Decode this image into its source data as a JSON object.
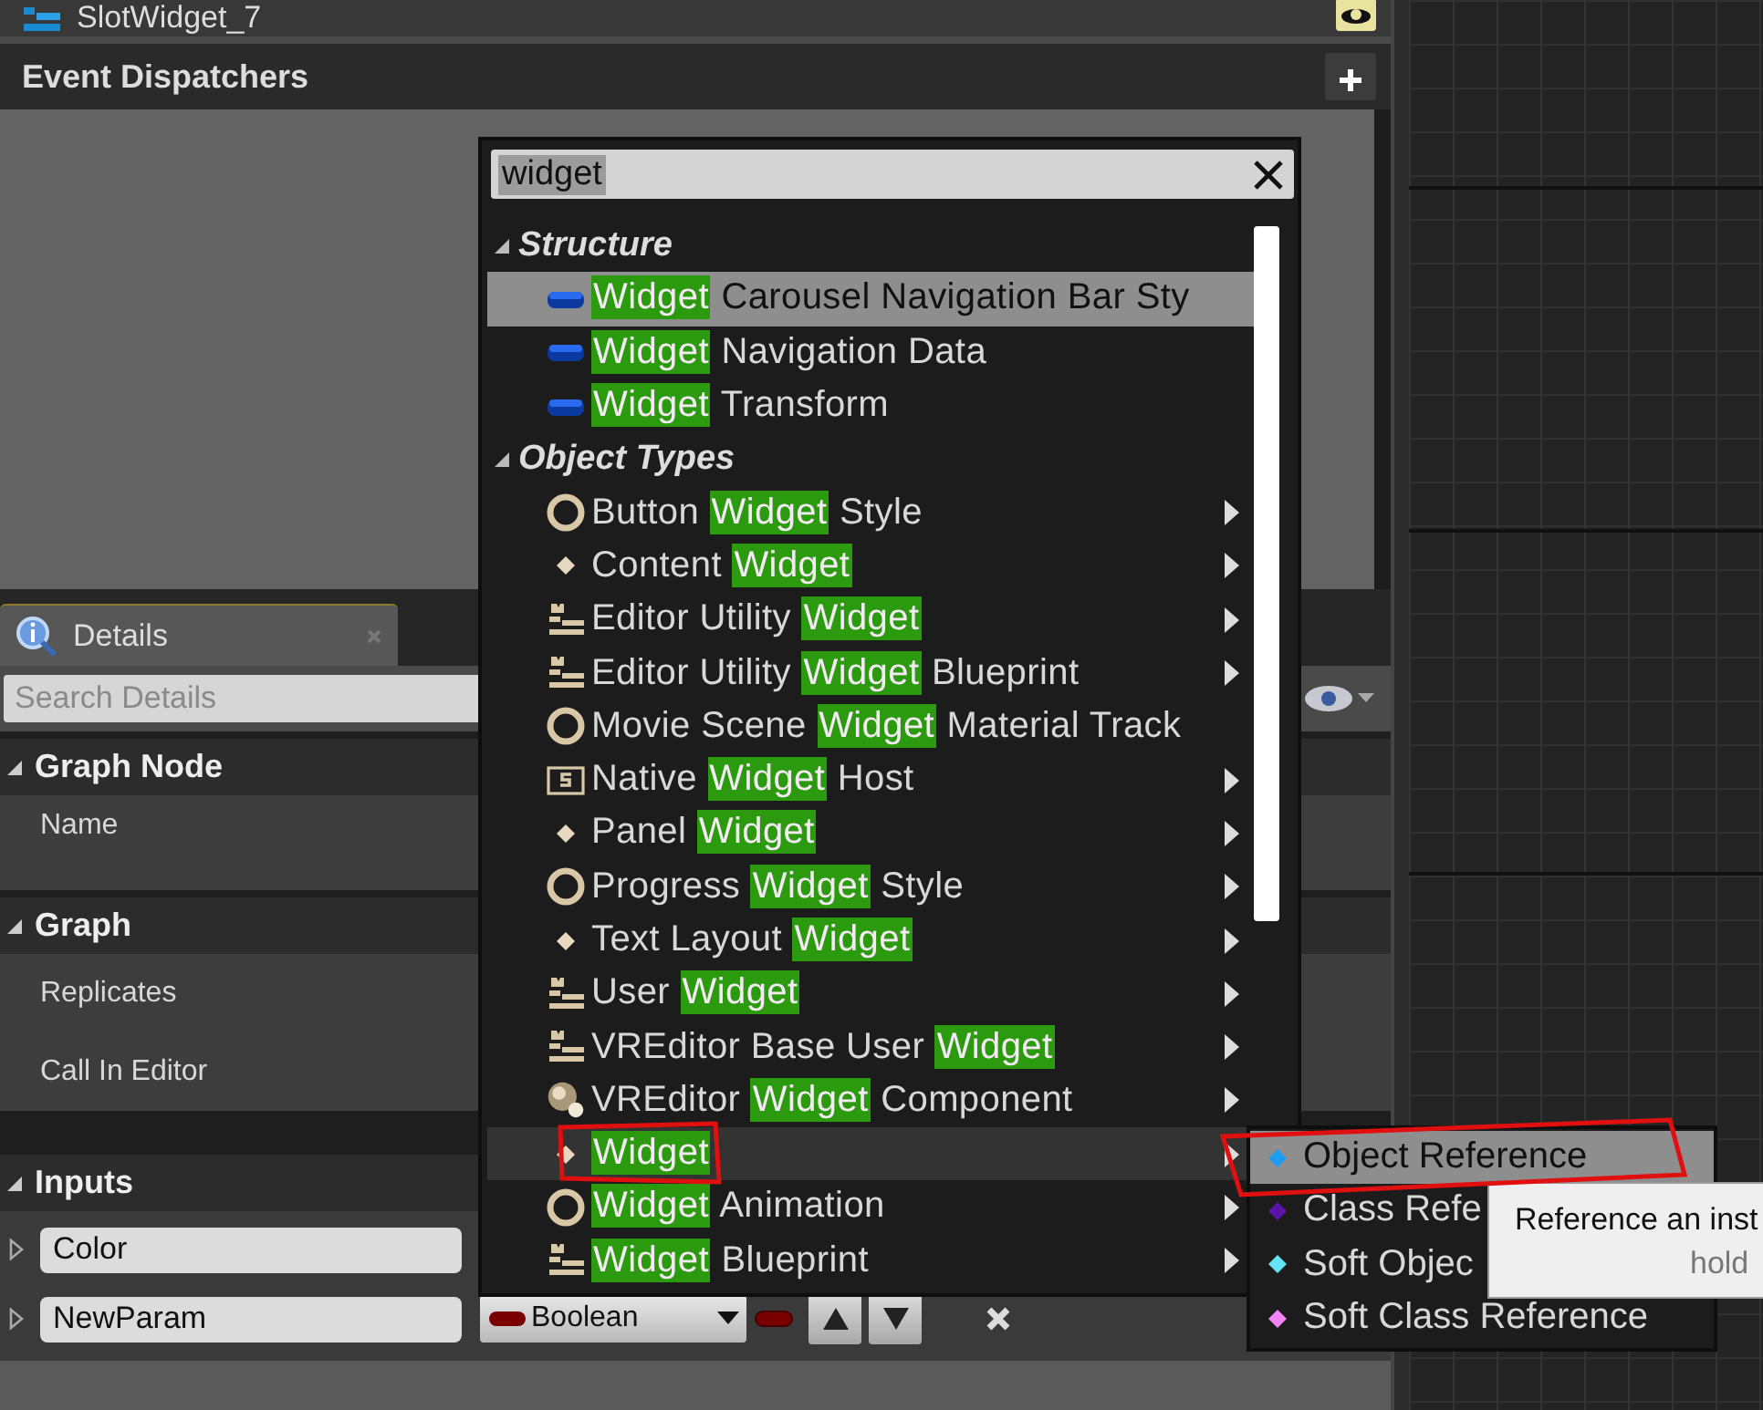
{
  "outliner_row": {
    "label": "SlotWidget_7"
  },
  "event_dispatchers": {
    "title": "Event Dispatchers"
  },
  "details": {
    "tab": "Details",
    "search": {
      "placeholder": "Search Details"
    },
    "sections": [
      {
        "title": "Graph Node",
        "expanded": true,
        "kind": "props",
        "rows": [
          "Name"
        ]
      },
      {
        "title": "Graph",
        "expanded": true,
        "kind": "props",
        "rows": [
          "Replicates",
          "Call In Editor"
        ]
      },
      {
        "title": "Inputs",
        "expanded": true,
        "kind": "inputs",
        "inputs": [
          {
            "value": "Color",
            "expanded": false
          },
          {
            "value": "NewParam",
            "expanded": false,
            "type": "Boolean"
          }
        ]
      }
    ]
  },
  "type_menu": {
    "search": {
      "value": "widget"
    },
    "categories": [
      {
        "title": "Structure",
        "expanded": true,
        "items": [
          {
            "kind": "struct",
            "match": "Widget",
            "after": " Carousel Navigation Bar Sty",
            "submenu": false,
            "selected": true,
            "open": false
          },
          {
            "kind": "struct",
            "match": "Widget",
            "after": " Navigation Data",
            "submenu": false,
            "selected": false,
            "open": false
          },
          {
            "kind": "struct",
            "match": "Widget",
            "after": " Transform",
            "submenu": false,
            "selected": false,
            "open": false
          }
        ]
      },
      {
        "title": "Object Types",
        "expanded": true,
        "items": [
          {
            "kind": "ring",
            "before": "Button ",
            "match": "Widget",
            "after": " Style",
            "submenu": true,
            "selected": false,
            "open": false
          },
          {
            "kind": "diamond",
            "before": "Content ",
            "match": "Widget",
            "submenu": true,
            "selected": false,
            "open": false
          },
          {
            "kind": "blueprint",
            "before": "Editor Utility ",
            "match": "Widget",
            "submenu": true,
            "selected": false,
            "open": false
          },
          {
            "kind": "blueprint",
            "before": "Editor Utility ",
            "match": "Widget",
            "after": " Blueprint",
            "submenu": true,
            "selected": false,
            "open": false
          },
          {
            "kind": "ring",
            "before": "Movie Scene ",
            "match": "Widget",
            "after": " Material Track",
            "submenu": false,
            "selected": false,
            "open": false
          },
          {
            "kind": "native",
            "before": "Native ",
            "match": "Widget",
            "after": " Host",
            "submenu": true,
            "selected": false,
            "open": false
          },
          {
            "kind": "diamond",
            "before": "Panel ",
            "match": "Widget",
            "submenu": true,
            "selected": false,
            "open": false
          },
          {
            "kind": "ring",
            "before": "Progress ",
            "match": "Widget",
            "after": " Style",
            "submenu": true,
            "selected": false,
            "open": false
          },
          {
            "kind": "diamond",
            "before": "Text Layout ",
            "match": "Widget",
            "submenu": true,
            "selected": false,
            "open": false
          },
          {
            "kind": "blueprint",
            "before": "User ",
            "match": "Widget",
            "submenu": true,
            "selected": false,
            "open": false
          },
          {
            "kind": "blueprint",
            "before": "VREditor Base User ",
            "match": "Widget",
            "submenu": true,
            "selected": false,
            "open": false
          },
          {
            "kind": "sphere",
            "before": "VREditor ",
            "match": "Widget",
            "after": " Component",
            "submenu": true,
            "selected": false,
            "open": false
          },
          {
            "kind": "diamond",
            "match": "Widget",
            "submenu": true,
            "selected": false,
            "open": true
          },
          {
            "kind": "ring",
            "match": "Widget",
            "after": " Animation",
            "submenu": true,
            "selected": false,
            "open": false
          },
          {
            "kind": "blueprint",
            "match": "Widget",
            "after": " Blueprint",
            "submenu": true,
            "selected": false,
            "open": false
          }
        ]
      }
    ]
  },
  "submenu": {
    "items": [
      {
        "label": "Object Reference",
        "color": "#1e9cf0",
        "selected": true
      },
      {
        "label": "Class Refe",
        "color": "#5b16a8",
        "selected": false
      },
      {
        "label": "Soft Objec",
        "color": "#64e4f4",
        "selected": false
      },
      {
        "label": "Soft Class Reference",
        "color": "#f484f4",
        "selected": false
      }
    ]
  },
  "tooltip": {
    "lines": [
      "Reference an inst",
      "hold"
    ]
  }
}
